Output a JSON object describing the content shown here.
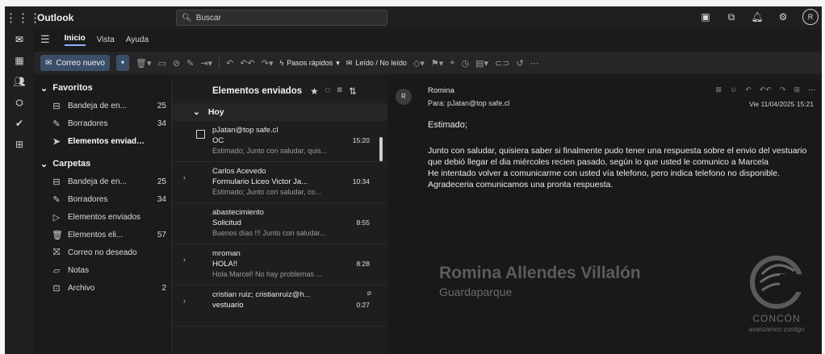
{
  "app": {
    "name": "Outlook"
  },
  "search": {
    "label": "Buscar"
  },
  "user": {
    "initial": "R"
  },
  "ribbon": {
    "tabs": [
      "Inicio",
      "Vista",
      "Ayuda"
    ]
  },
  "toolbar": {
    "new_mail": "Correo nuevo",
    "quick_steps": "Pasos rápidos",
    "read_unread": "Leído / No leído"
  },
  "folders": {
    "favorites_label": "Favoritos",
    "favorites": [
      {
        "name": "Bandeja de en...",
        "count": "25"
      },
      {
        "name": "Borradores",
        "count": "34"
      },
      {
        "name": "Elementos enviados",
        "count": ""
      }
    ],
    "folders_label": "Carpetas",
    "folders": [
      {
        "name": "Bandeja de en...",
        "count": "25"
      },
      {
        "name": "Borradores",
        "count": "34"
      },
      {
        "name": "Elementos enviados",
        "count": ""
      },
      {
        "name": "Elementos eli...",
        "count": "57"
      },
      {
        "name": "Correo no deseado",
        "count": ""
      },
      {
        "name": "Notas",
        "count": ""
      },
      {
        "name": "Archivo",
        "count": "2"
      }
    ]
  },
  "message_list": {
    "title": "Elementos enviados",
    "group": "Hoy",
    "messages": [
      {
        "sender": "pJatan@top safe.cl",
        "subject": "OC",
        "time": "15:20",
        "preview": "Estimado; Junto con saludar, quis..."
      },
      {
        "sender": "Carlos Acevedo",
        "subject": "Formulario Liceo Victor Ja...",
        "time": "10:34",
        "preview": "Estimado; Junto con saludar, co..."
      },
      {
        "sender": "abastecimiento",
        "subject": "Solicitud",
        "time": "8:55",
        "preview": "Buenos días !!! Junto con saludar..."
      },
      {
        "sender": "mroman",
        "subject": "HOLA!!",
        "time": "8:28",
        "preview": "Hola Marcel! No hay problemas ..."
      },
      {
        "sender": "cristian ruiz; cristianruiz@h...",
        "subject": "vestuario",
        "time": "0:27",
        "preview": ""
      }
    ]
  },
  "reading": {
    "avatar": "R",
    "from": "Romina",
    "to": "Para: pJatan@top safe.cl",
    "date": "Vie 11/04/2025 15:21",
    "greeting": "Estimado;",
    "paragraphs": [
      "Junto con saludar,  quisiera saber si finalmente pudo tener una respuesta sobre el envio del vestuario que debió llegar el dia miércoles recien pasado, según lo que usted le comunico a Marcela",
      "He intentado volver a comunicarme con usted vía telefono, pero indica telefono no disponible.",
      "Agradeceria comunicamos una pronta respuesta."
    ],
    "signature_name": "Romina Allendes Villalón",
    "signature_role": "Guardaparque",
    "logo_text": "CONCÓN",
    "logo_sub": "avanzamos contigo"
  }
}
